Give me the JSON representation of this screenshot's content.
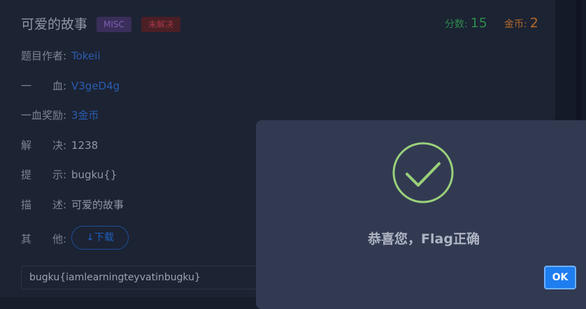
{
  "challenge": {
    "title": "可爱的故事",
    "category_badge": "MISC",
    "status_badge": "未解决",
    "points_label": "分数:",
    "points_value": "15",
    "coins_label": "金币:",
    "coins_value": "2"
  },
  "details": {
    "author_label": "题目作者:",
    "author_value": "Tokeii",
    "first_blood_label": "一　　血:",
    "first_blood_value": "V3geD4g",
    "first_blood_reward_label": "一血奖励:",
    "first_blood_reward_value": "3金币",
    "solves_label": "解　　决:",
    "solves_value": "1238",
    "hint_label": "提　　示:",
    "hint_value": "bugku{}",
    "description_label": "描　　述:",
    "description_value": "可爱的故事",
    "other_label": "其　　他:",
    "download_label": "下载"
  },
  "flag_input": {
    "value": "bugku{iamlearningteyvatinbugku}"
  },
  "modal": {
    "message": "恭喜您，Flag正确",
    "ok_label": "OK"
  },
  "colors": {
    "success_check": "#9ad07a",
    "ok_button": "#1e7ef0"
  }
}
